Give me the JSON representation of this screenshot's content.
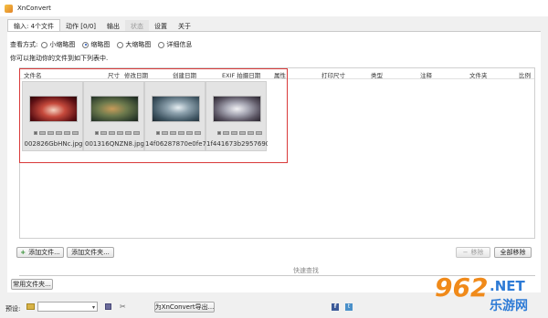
{
  "app": {
    "title": "XnConvert",
    "brand_color": "#f0a030"
  },
  "tabs": [
    {
      "label": "输入: 4个文件",
      "active": true,
      "disabled": false
    },
    {
      "label": "动作 [0/0]",
      "active": false,
      "disabled": false
    },
    {
      "label": "输出",
      "active": false,
      "disabled": false
    },
    {
      "label": "状态",
      "active": false,
      "disabled": true
    },
    {
      "label": "设置",
      "active": false,
      "disabled": false
    },
    {
      "label": "关于",
      "active": false,
      "disabled": false
    }
  ],
  "view": {
    "label": "查看方式:",
    "options": [
      "小缩略图",
      "缩略图",
      "大缩略图",
      "详细信息"
    ],
    "selected": "缩略图",
    "hint": "你可以拖动你的文件到如下列表中."
  },
  "columns": [
    "文件名",
    "尺寸",
    "修改日期",
    "创建日期",
    "EXIF 拍摄日期",
    "属性",
    "打印尺寸",
    "类型",
    "注释",
    "文件夹",
    "比例"
  ],
  "files": [
    {
      "name": "002826GbHNc.jpg",
      "image": "anime-illustration-red"
    },
    {
      "name": "001316QNZN8.jpg",
      "image": "anime-illustration-green"
    },
    {
      "name": "14f06287870e0fe78...",
      "image": "anime-portrait-blue"
    },
    {
      "name": "1f441673b2957690f...",
      "image": "anime-illustration-gray"
    }
  ],
  "buttons": {
    "add_files": "添加文件...",
    "add_folder": "添加文件夹...",
    "remove": "移除",
    "remove_all": "全部移除",
    "common_folders": "常用文件夹...",
    "export": "为XnConvert导出..."
  },
  "search": {
    "placeholder": "快速查找"
  },
  "footer": {
    "preset_label": "预设:",
    "preset_value": ""
  },
  "colors": {
    "selection_border": "#d93a3a",
    "watermark_orange": "#f08a1a",
    "watermark_blue": "#2e7bd6"
  },
  "watermark": {
    "number": "962",
    "tld": ".NET",
    "site": "乐游网"
  }
}
